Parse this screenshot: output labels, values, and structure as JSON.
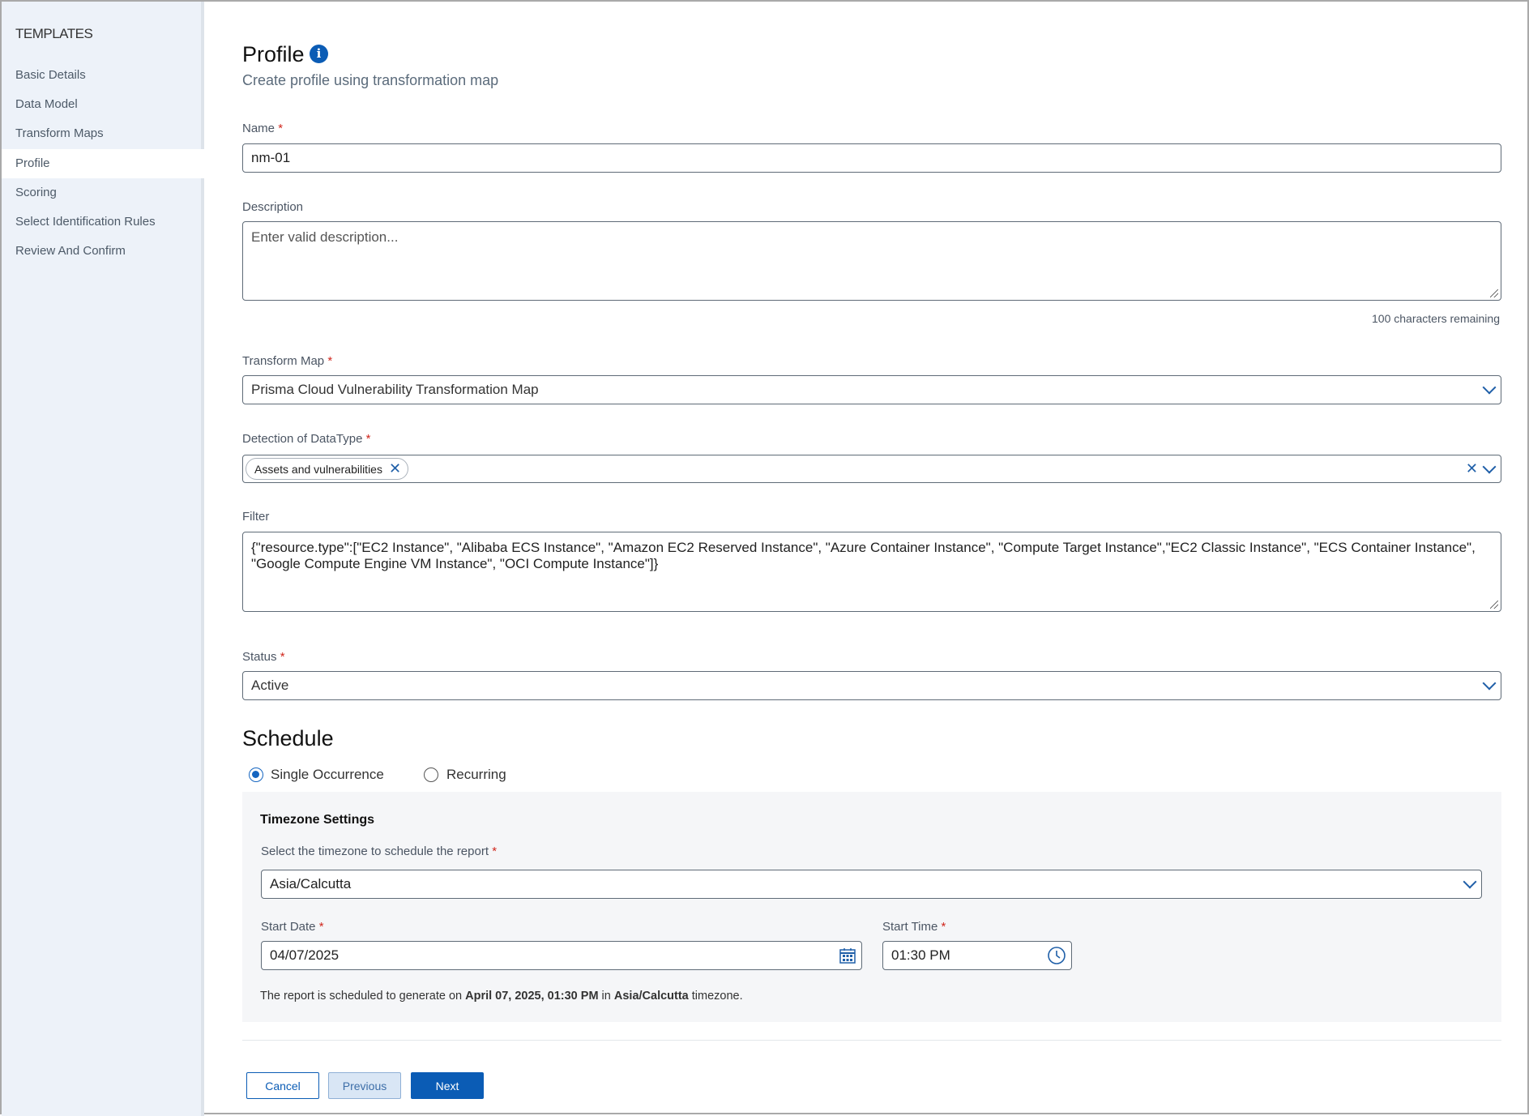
{
  "sidebar": {
    "heading": "TEMPLATES",
    "items": [
      {
        "label": "Basic Details"
      },
      {
        "label": "Data Model"
      },
      {
        "label": "Transform Maps"
      },
      {
        "label": "Profile",
        "active": true
      },
      {
        "label": "Scoring"
      },
      {
        "label": "Select Identification Rules"
      },
      {
        "label": "Review And Confirm"
      }
    ]
  },
  "header": {
    "title": "Profile",
    "info_icon": "info-icon",
    "subtitle": "Create profile using transformation map"
  },
  "form": {
    "name": {
      "label": "Name",
      "required": "*",
      "value": "nm-01"
    },
    "description": {
      "label": "Description",
      "placeholder": "Enter valid description...",
      "value": "",
      "counter": "100 characters remaining"
    },
    "transform_map": {
      "label": "Transform Map",
      "required": "*",
      "value": "Prisma Cloud Vulnerability Transformation Map"
    },
    "detection": {
      "label": "Detection of DataType",
      "required": "*",
      "chips": [
        "Assets and vulnerabilities"
      ]
    },
    "filter": {
      "label": "Filter",
      "value": "{\"resource.type\":[\"EC2 Instance\", \"Alibaba ECS Instance\", \"Amazon EC2 Reserved Instance\", \"Azure Container Instance\", \"Compute Target Instance\",\"EC2 Classic Instance\", \"ECS Container Instance\", \"Google Compute Engine VM Instance\", \"OCI Compute Instance\"]}"
    },
    "status": {
      "label": "Status",
      "required": "*",
      "value": "Active"
    }
  },
  "schedule": {
    "title": "Schedule",
    "options": [
      {
        "label": "Single Occurrence",
        "selected": true
      },
      {
        "label": "Recurring",
        "selected": false
      }
    ],
    "timezone": {
      "title": "Timezone Settings",
      "label": "Select the timezone to schedule the report",
      "required": "*",
      "value": "Asia/Calcutta"
    },
    "start_date": {
      "label": "Start Date",
      "required": "*",
      "value": "04/07/2025"
    },
    "start_time": {
      "label": "Start Time",
      "required": "*",
      "value": "01:30 PM"
    },
    "summary": {
      "prefix": "The report is scheduled to generate on ",
      "datetime": "April 07, 2025, 01:30 PM",
      "mid": " in ",
      "tz": "Asia/Calcutta",
      "suffix": " timezone."
    }
  },
  "buttons": {
    "cancel": "Cancel",
    "previous": "Previous",
    "next": "Next"
  },
  "colors": {
    "accent": "#0b5cb5",
    "sidebar_bg": "#edf2f9",
    "required": "#d0271d"
  }
}
